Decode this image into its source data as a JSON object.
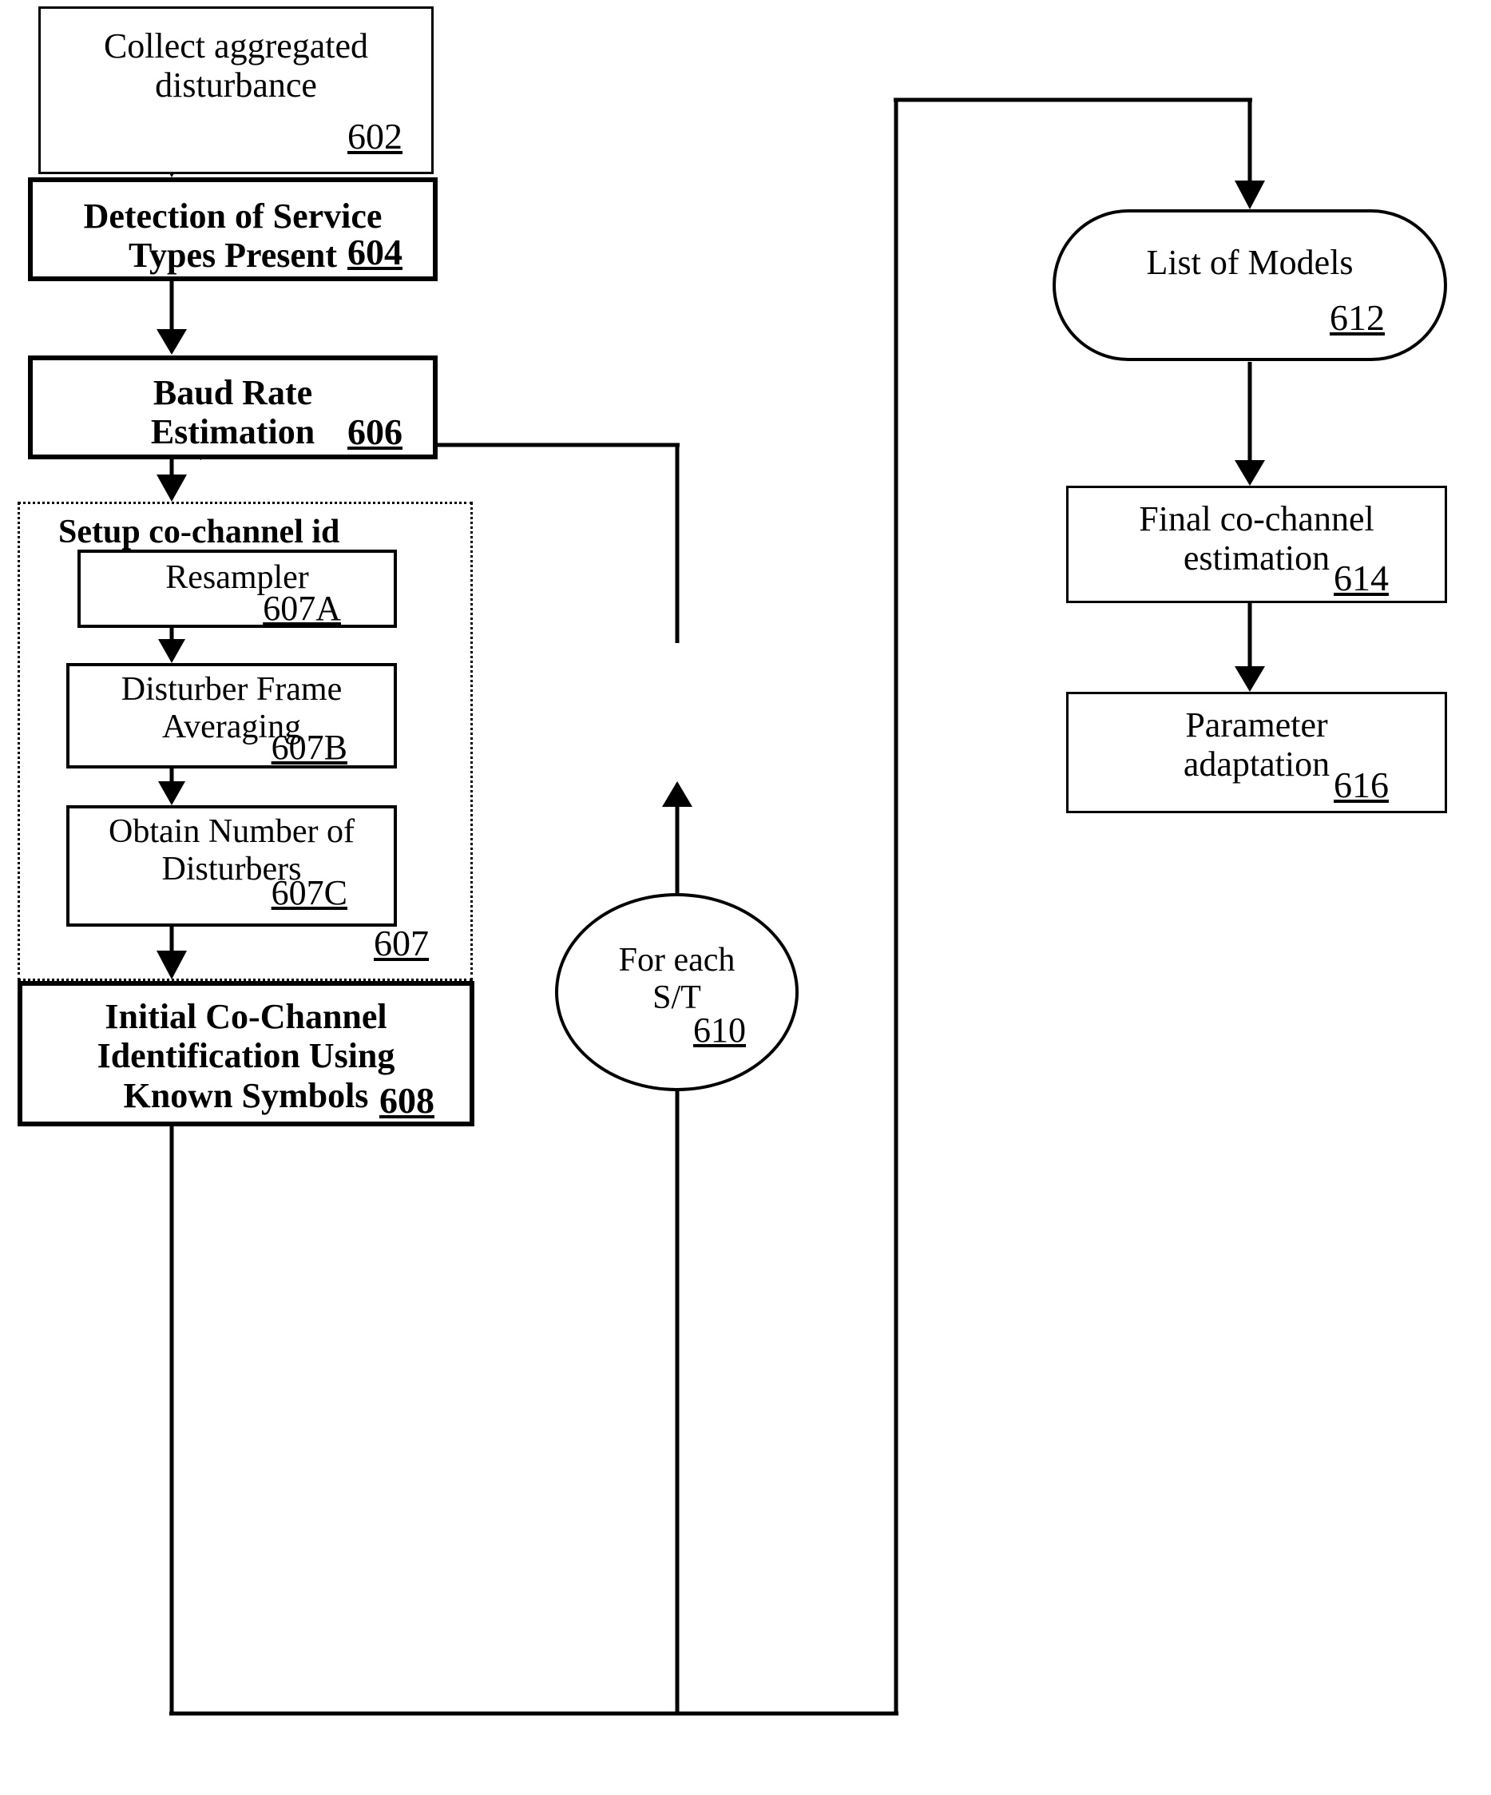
{
  "figure": {
    "type": "process-flowchart",
    "background_color": "#ffffff",
    "line_color": "#000000"
  },
  "nodes": {
    "collect": {
      "label": "Collect aggregated\ndisturbance",
      "ref": "602",
      "style": "thin-box",
      "weight": "plain"
    },
    "detection": {
      "label": "Detection of Service\nTypes Present",
      "ref": "604",
      "style": "thick-box",
      "weight": "bold"
    },
    "baud": {
      "label": "Baud Rate\nEstimation",
      "ref": "606",
      "style": "thick-box",
      "weight": "bold"
    },
    "setup_group": {
      "label": "Setup co-channel id",
      "ref": "607",
      "style": "dotted-box",
      "weight": "bold"
    },
    "resampler": {
      "label": "Resampler",
      "ref": "607A",
      "style": "inner-box",
      "weight": "plain"
    },
    "frame_avg": {
      "label": "Disturber Frame\nAveraging",
      "ref": "607B",
      "style": "inner-box",
      "weight": "plain"
    },
    "obtain_num": {
      "label": "Obtain Number of\nDisturbers",
      "ref": "607C",
      "style": "inner-box",
      "weight": "plain"
    },
    "initial_id": {
      "label": "Initial Co-Channel\nIdentification Using\nKnown Symbols",
      "ref": "608",
      "style": "thick-box",
      "weight": "bold"
    },
    "for_each": {
      "label": "For each\nS/T",
      "ref": "610",
      "style": "ellipse-box",
      "weight": "plain"
    },
    "list_models": {
      "label": "List of Models",
      "ref": "612",
      "style": "rounded-box",
      "weight": "plain"
    },
    "final_est": {
      "label": "Final co-channel\nestimation",
      "ref": "614",
      "style": "thin-box",
      "weight": "plain"
    },
    "param_adapt": {
      "label": "Parameter\nadaptation",
      "ref": "616",
      "style": "thin-box",
      "weight": "plain"
    }
  },
  "edges": [
    {
      "from": "collect",
      "to": "detection",
      "kind": "arrow-down"
    },
    {
      "from": "detection",
      "to": "baud",
      "kind": "arrow-down"
    },
    {
      "from": "baud",
      "to": "setup_group",
      "kind": "arrow-down"
    },
    {
      "from": "resampler",
      "to": "frame_avg",
      "kind": "arrow-down"
    },
    {
      "from": "frame_avg",
      "to": "obtain_num",
      "kind": "arrow-down"
    },
    {
      "from": "obtain_num",
      "to": "initial_id",
      "kind": "arrow-down"
    },
    {
      "from": "initial_id",
      "to": "for_each",
      "kind": "routed-arrow-up"
    },
    {
      "from": "for_each",
      "to": "baud",
      "kind": "feedback-arrow-left"
    },
    {
      "from": "initial_id",
      "to": "list_models",
      "kind": "routed-arrow-up"
    },
    {
      "from": "list_models",
      "to": "final_est",
      "kind": "arrow-down"
    },
    {
      "from": "final_est",
      "to": "param_adapt",
      "kind": "arrow-down"
    }
  ]
}
